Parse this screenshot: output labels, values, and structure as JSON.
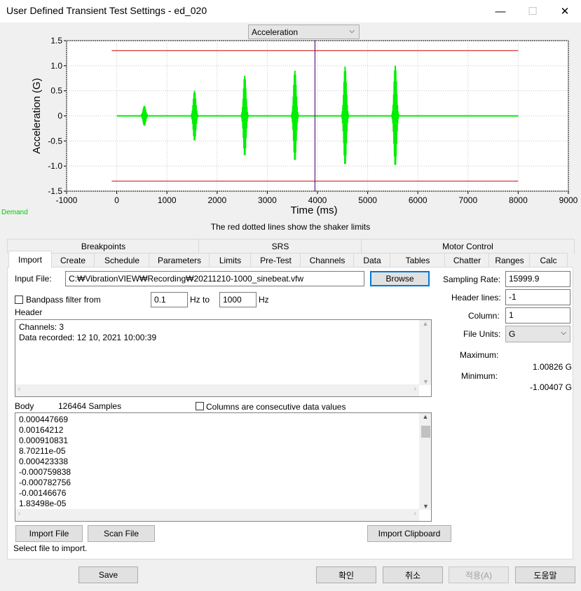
{
  "window": {
    "title": "User Defined Transient Test Settings - ed_020",
    "minimize": "—",
    "maximize": "☐",
    "close": "✕"
  },
  "chart_select": {
    "value": "Acceleration"
  },
  "chart_data": {
    "type": "line",
    "xlabel": "Time (ms)",
    "ylabel": "Acceleration (G)",
    "xlim": [
      -1000,
      9000
    ],
    "ylim": [
      -1.5,
      1.5
    ],
    "xticks": [
      "-1000",
      "0",
      "1000",
      "2000",
      "3000",
      "4000",
      "5000",
      "6000",
      "7000",
      "8000",
      "9000"
    ],
    "yticks": [
      "1.5",
      "1.0",
      "0.5",
      "0",
      "-0.5",
      "-1.0",
      "-1.5"
    ],
    "series": [
      {
        "color": "#00ee00",
        "x": [
          0,
          8000
        ],
        "y": [
          0,
          0
        ]
      },
      {
        "color": "#cc2222",
        "x": [
          -100,
          8000
        ],
        "y": [
          1.3,
          1.3
        ]
      },
      {
        "color": "#cc2222",
        "x": [
          -100,
          8000
        ],
        "y": [
          -1.3,
          -1.3
        ]
      }
    ],
    "bursts": [
      {
        "x": 550,
        "amp": 0.2
      },
      {
        "x": 1550,
        "amp": 0.5
      },
      {
        "x": 2550,
        "amp": 0.8
      },
      {
        "x": 3550,
        "amp": 0.9
      },
      {
        "x": 4550,
        "amp": 0.98
      },
      {
        "x": 5550,
        "amp": 1.0
      }
    ],
    "cursor_x": 3950,
    "demand_label": "Demand",
    "note": "The red dotted lines show the shaker limits"
  },
  "tabs_top": [
    "Breakpoints",
    "SRS",
    "Motor Control"
  ],
  "tabs": [
    "Import",
    "Create",
    "Schedule",
    "Parameters",
    "Limits",
    "Pre-Test",
    "Channels",
    "Data",
    "Tables",
    "Chatter",
    "Ranges",
    "Calc"
  ],
  "import": {
    "input_file_label": "Input File:",
    "input_file_value": "C:₩VibrationVIEW₩Recording₩20211210-1000_sinebeat.vfw",
    "browse": "Browse",
    "bandpass_label": "Bandpass filter from",
    "bandpass_from": "0.1",
    "hz_to": "Hz to",
    "bandpass_to": "1000",
    "hz": "Hz",
    "header_label": "Header",
    "header_lines": [
      "Channels: 3",
      "Data recorded: 12 10, 2021 10:00:39"
    ],
    "body_label": "Body",
    "samples": "126464 Samples",
    "consecutive_label": "Columns are consecutive data values",
    "body_lines": [
      "0.000447669",
      "0.00164212",
      "0.000910831",
      "8.70211e-05",
      "0.000423338",
      "-0.000759838",
      "-0.000782756",
      "-0.00146676",
      "1.83498e-05"
    ],
    "import_file": "Import File",
    "scan_file": "Scan File",
    "import_clipboard": "Import Clipboard",
    "status": "Select file to import.",
    "sampling_rate_label": "Sampling Rate:",
    "sampling_rate": "15999.9",
    "header_lines_label": "Header lines:",
    "header_lines_value": "-1",
    "column_label": "Column:",
    "column_value": "1",
    "file_units_label": "File Units:",
    "file_units_value": "G",
    "maximum_label": "Maximum:",
    "maximum_value": "1.00826 G",
    "minimum_label": "Minimum:",
    "minimum_value": "-1.00407 G"
  },
  "footer": {
    "save": "Save",
    "ok": "확인",
    "cancel": "취소",
    "apply": "적용(A)",
    "help": "도움말"
  }
}
